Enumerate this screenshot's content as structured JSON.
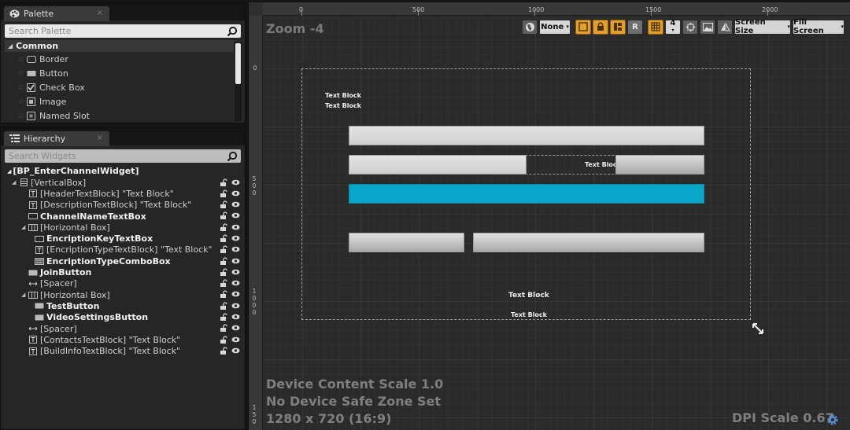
{
  "palette": {
    "tab_title": "Palette",
    "tab_icon": "palette-icon",
    "close_glyph": "×",
    "search_placeholder": "Search Palette",
    "category": "Common",
    "items": [
      {
        "label": "Border",
        "icon": "border-widget-icon"
      },
      {
        "label": "Button",
        "icon": "button-widget-icon"
      },
      {
        "label": "Check Box",
        "icon": "checkbox-widget-icon"
      },
      {
        "label": "Image",
        "icon": "image-widget-icon"
      },
      {
        "label": "Named Slot",
        "icon": "named-slot-widget-icon"
      }
    ]
  },
  "hierarchy": {
    "tab_title": "Hierarchy",
    "tab_icon": "hierarchy-icon",
    "close_glyph": "×",
    "search_placeholder": "Search Widgets",
    "root": "[BP_EnterChannelWidget]",
    "rows": [
      {
        "label": "[VerticalBox]",
        "bold": false,
        "expander": true,
        "icon": "vertical-box-icon"
      },
      {
        "label": "[HeaderTextBlock] \"Text Block\"",
        "bold": false,
        "expander": false,
        "icon": "text-block-icon"
      },
      {
        "label": "[DescriptionTextBlock] \"Text Block\"",
        "bold": false,
        "expander": false,
        "icon": "text-block-icon"
      },
      {
        "label": "ChannelNameTextBox",
        "bold": true,
        "expander": false,
        "icon": "text-box-icon"
      },
      {
        "label": "[Horizontal Box]",
        "bold": false,
        "expander": true,
        "icon": "horizontal-box-icon"
      },
      {
        "label": "EncriptionKeyTextBox",
        "bold": true,
        "expander": false,
        "icon": "text-box-icon"
      },
      {
        "label": "[EncriptionTypeTextBlock] \"Text Block\"",
        "bold": false,
        "expander": false,
        "icon": "text-block-icon"
      },
      {
        "label": "EncriptionTypeComboBox",
        "bold": true,
        "expander": false,
        "icon": "combo-box-icon"
      },
      {
        "label": "JoinButton",
        "bold": true,
        "expander": false,
        "icon": "button-widget-icon"
      },
      {
        "label": "[Spacer]",
        "bold": false,
        "expander": false,
        "icon": "spacer-icon"
      },
      {
        "label": "[Horizontal Box]",
        "bold": false,
        "expander": true,
        "icon": "horizontal-box-icon"
      },
      {
        "label": "TestButton",
        "bold": true,
        "expander": false,
        "icon": "button-widget-icon"
      },
      {
        "label": "VideoSettingsButton",
        "bold": true,
        "expander": false,
        "icon": "button-widget-icon"
      },
      {
        "label": "[Spacer]",
        "bold": false,
        "expander": false,
        "icon": "spacer-icon"
      },
      {
        "label": "[ContactsTextBlock] \"Text Block\"",
        "bold": false,
        "expander": false,
        "icon": "text-block-icon"
      },
      {
        "label": "[BuildInfoTextBlock] \"Text Block\"",
        "bold": false,
        "expander": false,
        "icon": "text-block-icon"
      }
    ]
  },
  "designer": {
    "zoom_label": "Zoom -4",
    "ruler_h_labels": [
      "0",
      "500",
      "1000",
      "1500",
      "2000"
    ],
    "ruler_v_labels": [
      "0",
      "500",
      "1000",
      "150"
    ],
    "toolbar": {
      "none_label": "None",
      "r_label": "R",
      "grid_snap_value": "4",
      "screen_size_label": "Screen Size",
      "fill_screen_label": "Fill Screen",
      "accent_color": "#e39f2e"
    },
    "widgets": {
      "text_block_1": "Text Block",
      "text_block_2": "Text Block",
      "combo_text": "Text Block",
      "footer_text_1": "Text Block",
      "footer_text_2": "Text Block",
      "join_button_color": "#0aa5c9"
    },
    "info": {
      "content_scale": "Device Content Scale 1.0",
      "safe_zone": "No Device Safe Zone Set",
      "resolution": "1280 x 720 (16:9)",
      "dpi_scale": "DPI Scale 0.67"
    }
  }
}
